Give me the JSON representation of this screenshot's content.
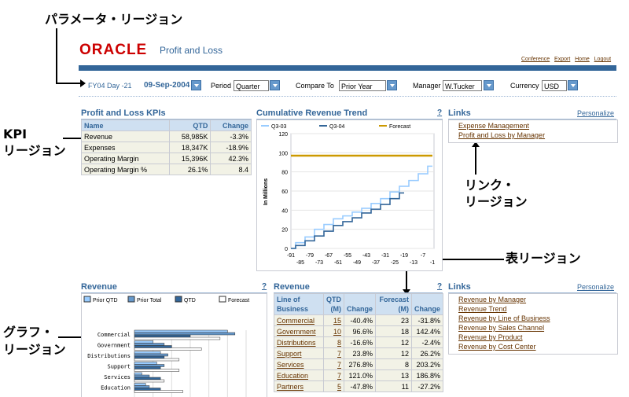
{
  "annotations": {
    "param": "パラメータ・リージョン",
    "kpi_line1": "KPI",
    "kpi_line2": "リージョン",
    "link_line1": "リンク・",
    "link_line2": "リージョン",
    "table": "表リージョン",
    "graph_line1": "グラフ・",
    "graph_line2": "リージョン"
  },
  "header": {
    "logo": "ORACLE",
    "app_title": "Profit and Loss",
    "global_links": [
      "Conference",
      "Export",
      "Home",
      "Logout"
    ]
  },
  "params": {
    "fy_day": "FY04 Day -21",
    "date": "09-Sep-2004",
    "period_label": "Period",
    "period_value": "Quarter",
    "compare_label": "Compare To",
    "compare_value": "Prior Year",
    "manager_label": "Manager",
    "manager_value": "W.Tucker",
    "currency_label": "Currency",
    "currency_value": "USD"
  },
  "kpi": {
    "title": "Profit and Loss KPIs",
    "headers": [
      "Name",
      "QTD",
      "Change"
    ],
    "rows": [
      [
        "Revenue",
        "58,985K",
        "-3.3%"
      ],
      [
        "Expenses",
        "18,347K",
        "-18.9%"
      ],
      [
        "Operating Margin",
        "15,396K",
        "42.3%"
      ],
      [
        "Operating Margin %",
        "26.1%",
        "8.4"
      ]
    ]
  },
  "trend": {
    "title": "Cumulative Revenue Trend",
    "help": "?"
  },
  "links1": {
    "title": "Links",
    "personalize": "Personalize",
    "items": [
      "Expense Management",
      "Profit and Loss by Manager"
    ]
  },
  "revenue_graph": {
    "title": "Revenue",
    "help": "?"
  },
  "revenue_table": {
    "title": "Revenue",
    "help": "?",
    "headers": [
      "Line of Business",
      "QTD (M)",
      "Change",
      "Forecast (M)",
      "Change"
    ],
    "rows": [
      [
        "Commercial",
        "15",
        "-40.4%",
        "23",
        "-31.8%"
      ],
      [
        "Government",
        "10",
        "96.6%",
        "18",
        "142.4%"
      ],
      [
        "Distributions",
        "8",
        "-16.6%",
        "12",
        "-2.4%"
      ],
      [
        "Support",
        "7",
        "23.8%",
        "12",
        "26.2%"
      ],
      [
        "Services",
        "7",
        "276.8%",
        "8",
        "203.2%"
      ],
      [
        "Education",
        "7",
        "121.0%",
        "13",
        "186.8%"
      ],
      [
        "Partners",
        "5",
        "-47.8%",
        "11",
        "-27.2%"
      ]
    ]
  },
  "links2": {
    "title": "Links",
    "personalize": "Personalize",
    "items": [
      "Revenue by Manager",
      "Revenue Trend",
      "Revenue by Line of Business",
      "Revenue by Sales Channel",
      "Revenue by Product",
      "Revenue by Cost Center"
    ]
  },
  "chart_data": [
    {
      "type": "line",
      "title": "Cumulative Revenue Trend",
      "ylabel": "In Millions",
      "ylim": [
        0,
        120
      ],
      "yticks": [
        0,
        20,
        40,
        60,
        80,
        100,
        120
      ],
      "xticks_top": [
        "-91",
        "-79",
        "-67",
        "-55",
        "-43",
        "-31",
        "-19",
        "-7"
      ],
      "xticks_bottom": [
        "-85",
        "-73",
        "-61",
        "-49",
        "-37",
        "-25",
        "-13",
        "-1"
      ],
      "xlim": [
        -91,
        0
      ],
      "legend_position": "top",
      "colors": {
        "Q3-03": "#99ccff",
        "Q3-04": "#336699",
        "Forecast": "#cc9900"
      },
      "series": [
        {
          "name": "Q3-03",
          "x": [
            -91,
            -85,
            -79,
            -73,
            -67,
            -61,
            -55,
            -49,
            -43,
            -37,
            -31,
            -25,
            -19,
            -13,
            -7,
            -1
          ],
          "y": [
            0,
            6,
            12,
            20,
            25,
            31,
            34,
            38,
            42,
            47,
            52,
            59,
            65,
            71,
            78,
            86
          ]
        },
        {
          "name": "Q3-04",
          "x": [
            -91,
            -85,
            -79,
            -73,
            -67,
            -61,
            -55,
            -49,
            -43,
            -37,
            -31,
            -25,
            -19
          ],
          "y": [
            0,
            3,
            8,
            13,
            18,
            24,
            28,
            32,
            37,
            41,
            46,
            52,
            58
          ]
        },
        {
          "name": "Forecast",
          "x": [
            -91,
            -1
          ],
          "y": [
            97,
            97
          ]
        }
      ]
    },
    {
      "type": "bar",
      "title": "Revenue",
      "legend_position": "top",
      "categories": [
        "Commercial",
        "Government",
        "Distributions",
        "Support",
        "Services",
        "Education"
      ],
      "xlim": [
        0,
        30
      ],
      "series": [
        {
          "name": "Prior QTD",
          "color": "#99ccff",
          "values": [
            25,
            5,
            7,
            6,
            2,
            3
          ]
        },
        {
          "name": "Prior Total",
          "color": "#6699cc",
          "values": [
            27,
            8,
            9,
            8,
            4,
            4
          ]
        },
        {
          "name": "QTD",
          "color": "#336699",
          "values": [
            15,
            10,
            8,
            7,
            7,
            7
          ]
        },
        {
          "name": "Forecast",
          "color": "#ffffff",
          "values": [
            23,
            18,
            12,
            12,
            8,
            13
          ]
        }
      ]
    }
  ]
}
